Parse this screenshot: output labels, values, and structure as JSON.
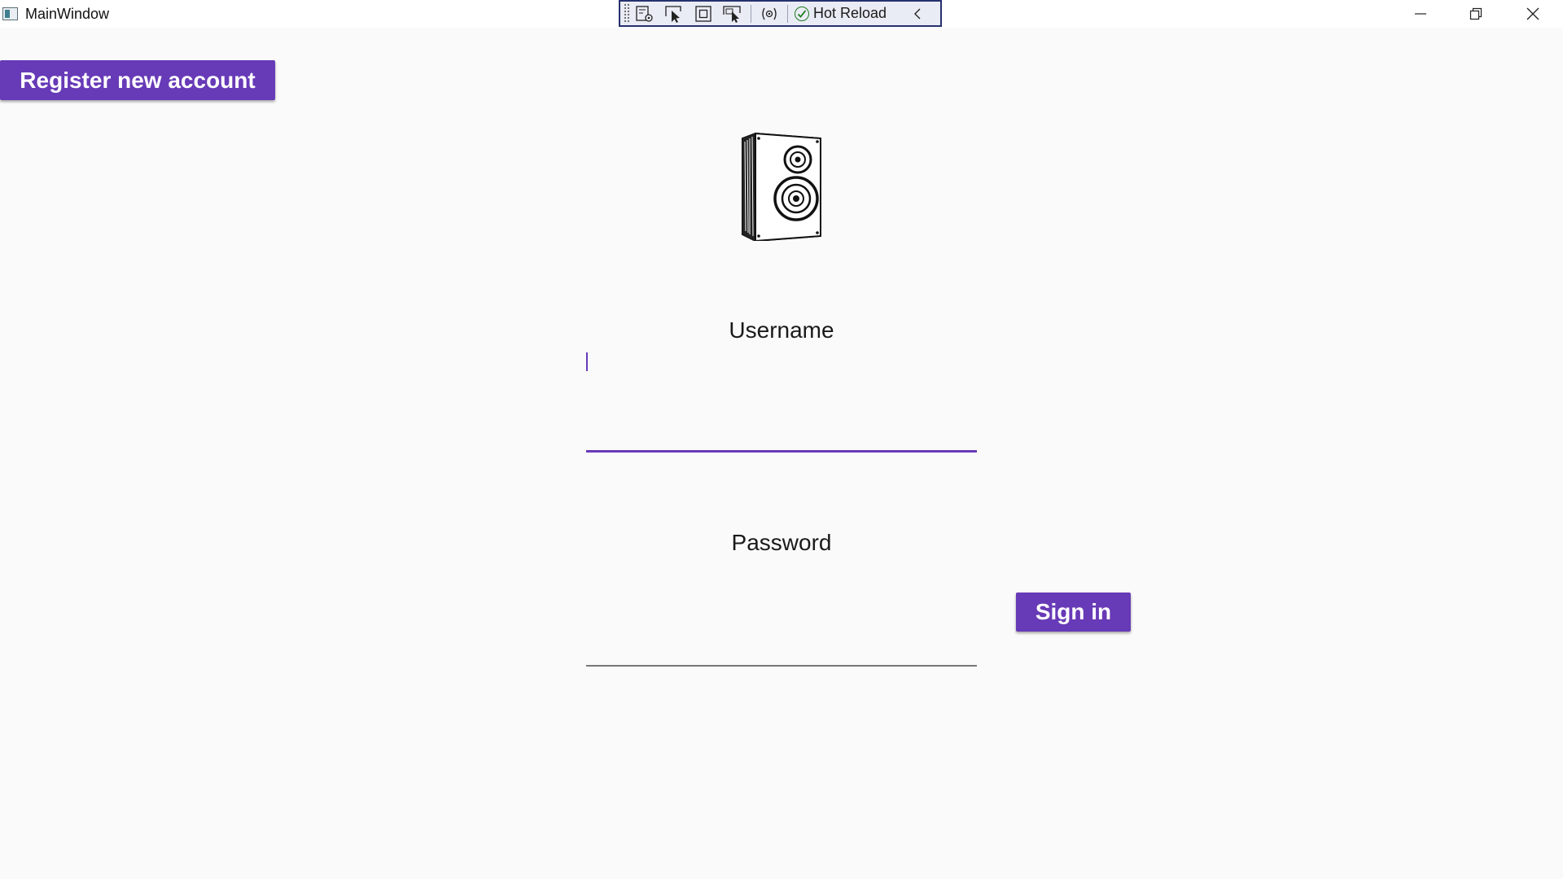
{
  "window": {
    "title": "MainWindow",
    "icons": {
      "app": "app-window-icon",
      "minimize": "minimize-icon",
      "restore": "restore-icon",
      "close": "close-icon"
    }
  },
  "debug_toolbar": {
    "hot_reload_label": "Hot Reload",
    "icons": [
      "grip-icon",
      "live-visual-tree-icon",
      "select-element-icon",
      "display-layout-adorners-icon",
      "track-focus-icon",
      "binding-failures-icon",
      "hot-reload-check-icon",
      "chevron-left-icon"
    ]
  },
  "actions": {
    "register_label": "Register new account",
    "signin_label": "Sign in"
  },
  "form": {
    "username_label": "Username",
    "username_value": "",
    "password_label": "Password",
    "password_value": ""
  },
  "logo": {
    "icon": "speaker-icon"
  },
  "colors": {
    "accent": "#673ab7",
    "background": "#fafafa",
    "toolbar_border": "#26306e"
  }
}
